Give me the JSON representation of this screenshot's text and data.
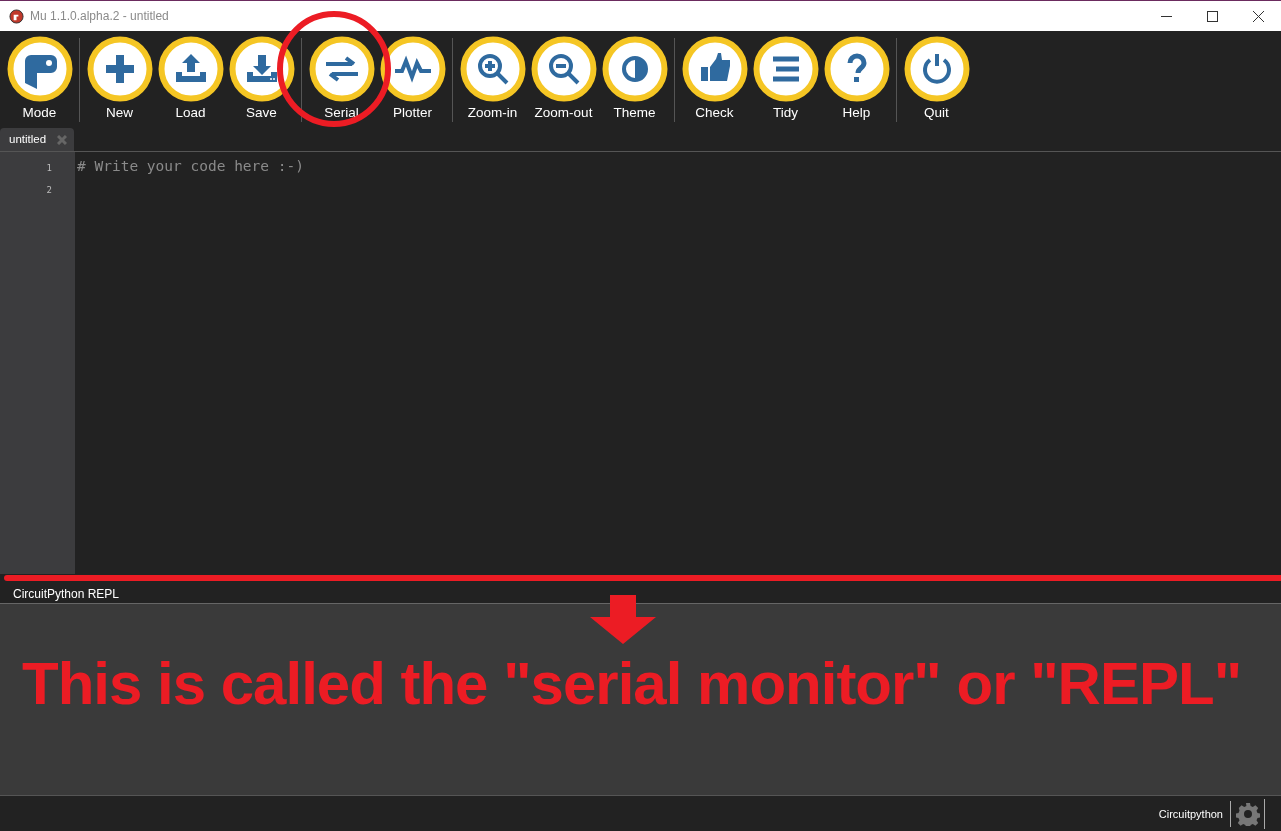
{
  "window": {
    "title": "Mu 1.1.0.alpha.2 - untitled"
  },
  "toolbar": [
    [
      {
        "label": "Mode"
      }
    ],
    [
      {
        "label": "New"
      },
      {
        "label": "Load"
      },
      {
        "label": "Save"
      }
    ],
    [
      {
        "label": "Serial"
      },
      {
        "label": "Plotter"
      }
    ],
    [
      {
        "label": "Zoom-in"
      },
      {
        "label": "Zoom-out"
      },
      {
        "label": "Theme"
      }
    ],
    [
      {
        "label": "Check"
      },
      {
        "label": "Tidy"
      },
      {
        "label": "Help"
      }
    ],
    [
      {
        "label": "Quit"
      }
    ]
  ],
  "tabs": [
    {
      "label": "untitled",
      "selected": true
    }
  ],
  "editor": {
    "line_numbers": [
      "1",
      "2"
    ],
    "lines": [
      "# Write your code here :-)"
    ]
  },
  "repl": {
    "title": "CircuitPython REPL"
  },
  "annotation": {
    "callout": "This is called the \"serial monitor\" or \"REPL\""
  },
  "status_bar": {
    "mode": "Circuitpython"
  }
}
